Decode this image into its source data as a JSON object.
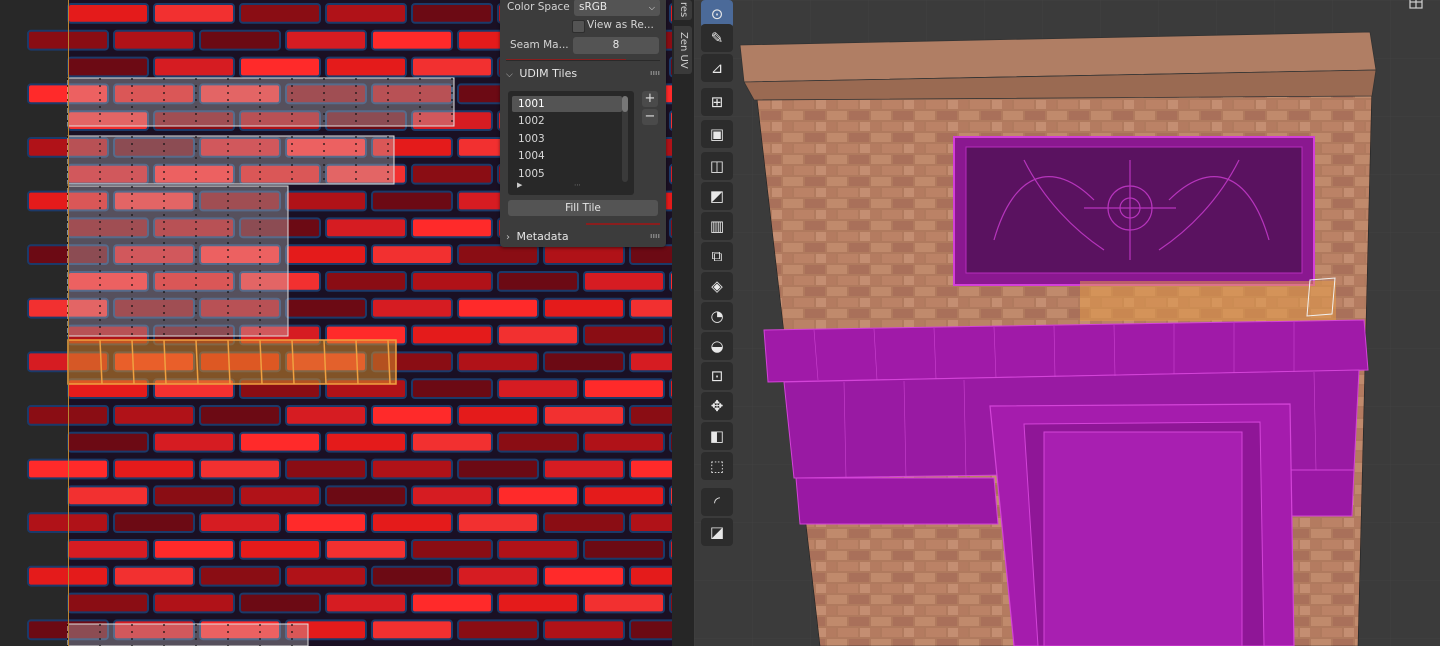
{
  "uv_panel": {
    "color_space_label": "Color Space",
    "color_space_value": "sRGB",
    "view_as_render_label": "View as Re...",
    "seam_margin_label": "Seam Ma...",
    "seam_margin_value": "8",
    "udim_section_title": "UDIM Tiles",
    "udim_tiles": [
      "1001",
      "1002",
      "1003",
      "1004",
      "1005"
    ],
    "udim_selected": "1001",
    "fill_tile_label": "Fill Tile",
    "metadata_section_title": "Metadata",
    "add_tile_label": "+",
    "remove_tile_label": "−"
  },
  "side_tabs": [
    "res",
    "Zen UV"
  ],
  "toolbar_tools": [
    "select-box-icon",
    "annotate-icon",
    "measure-icon",
    "add-cube-icon",
    "extrude-region-icon",
    "inset-faces-icon",
    "bevel-icon",
    "loop-cut-icon",
    "knife-icon",
    "poly-build-icon",
    "spin-icon",
    "smooth-vertices-icon",
    "edge-slide-icon",
    "shrink-fatten-icon",
    "shear-icon",
    "rip-region-icon",
    "transform-icon",
    "checker-icon"
  ],
  "colors": {
    "face_select_magenta": "#a01aa8",
    "uv_selection_orange": "#d78a2a",
    "brick_red": "#e21b1b",
    "panel_bg": "#3c3c3c",
    "viewport_bg": "#3b3b3b"
  }
}
